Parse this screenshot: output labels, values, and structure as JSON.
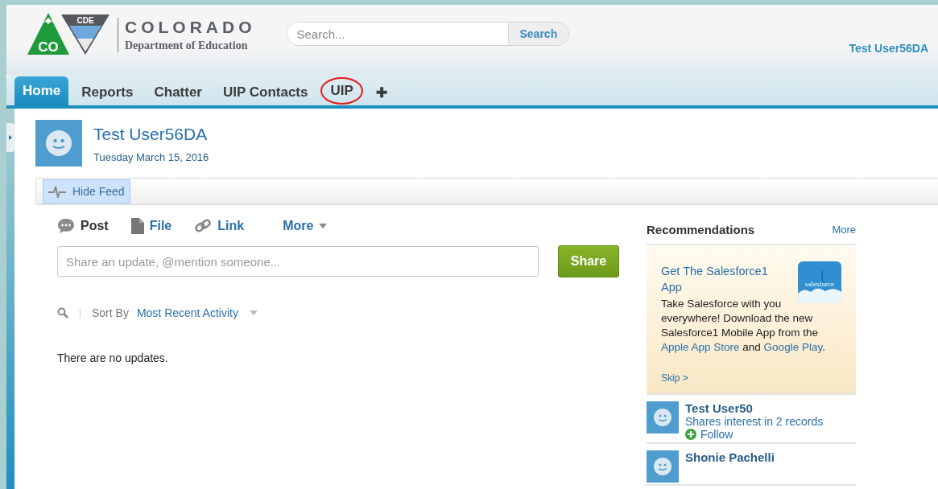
{
  "logo": {
    "badge": "CO",
    "tag": "CDE",
    "title": "COLORADO",
    "subtitle": "Department of Education"
  },
  "search": {
    "placeholder": "Search...",
    "button": "Search"
  },
  "user_menu": "Test User56DA",
  "tabs": [
    {
      "label": "Home",
      "selected": true,
      "circled": false
    },
    {
      "label": "Reports",
      "selected": false,
      "circled": false
    },
    {
      "label": "Chatter",
      "selected": false,
      "circled": false
    },
    {
      "label": "UIP Contacts",
      "selected": false,
      "circled": false
    },
    {
      "label": "UIP",
      "selected": false,
      "circled": true
    },
    {
      "label": "✚",
      "selected": false,
      "circled": false
    }
  ],
  "profile": {
    "name": "Test User56DA",
    "date": "Tuesday March 15, 2016"
  },
  "feed_toggle": "Hide Feed",
  "composer": {
    "actions": [
      {
        "kind": "post",
        "label": "Post",
        "selected": true
      },
      {
        "kind": "file",
        "label": "File",
        "selected": false
      },
      {
        "kind": "link",
        "label": "Link",
        "selected": false
      },
      {
        "kind": "more",
        "label": "More",
        "selected": false
      }
    ],
    "placeholder": "Share an update, @mention someone...",
    "button": "Share"
  },
  "sort": {
    "label": "Sort By",
    "value": "Most Recent Activity"
  },
  "empty_message": "There are no updates.",
  "recommendations": {
    "title": "Recommendations",
    "more": "More",
    "promo": {
      "title": "Get The Salesforce1 App",
      "app_icon_text": "salesforce",
      "app_icon_number": "1",
      "body": "Take Salesforce with you everywhere! Download the new Salesforce1 Mobile App from the ",
      "link1": "Apple App Store",
      "between": " and ",
      "link2": "Google Play",
      "end": ".",
      "skip": "Skip >"
    },
    "people": [
      {
        "name": "Test User50",
        "reason": "Shares interest in 2 records",
        "action": "Follow"
      },
      {
        "name": "Shonie Pachelli"
      }
    ]
  }
}
